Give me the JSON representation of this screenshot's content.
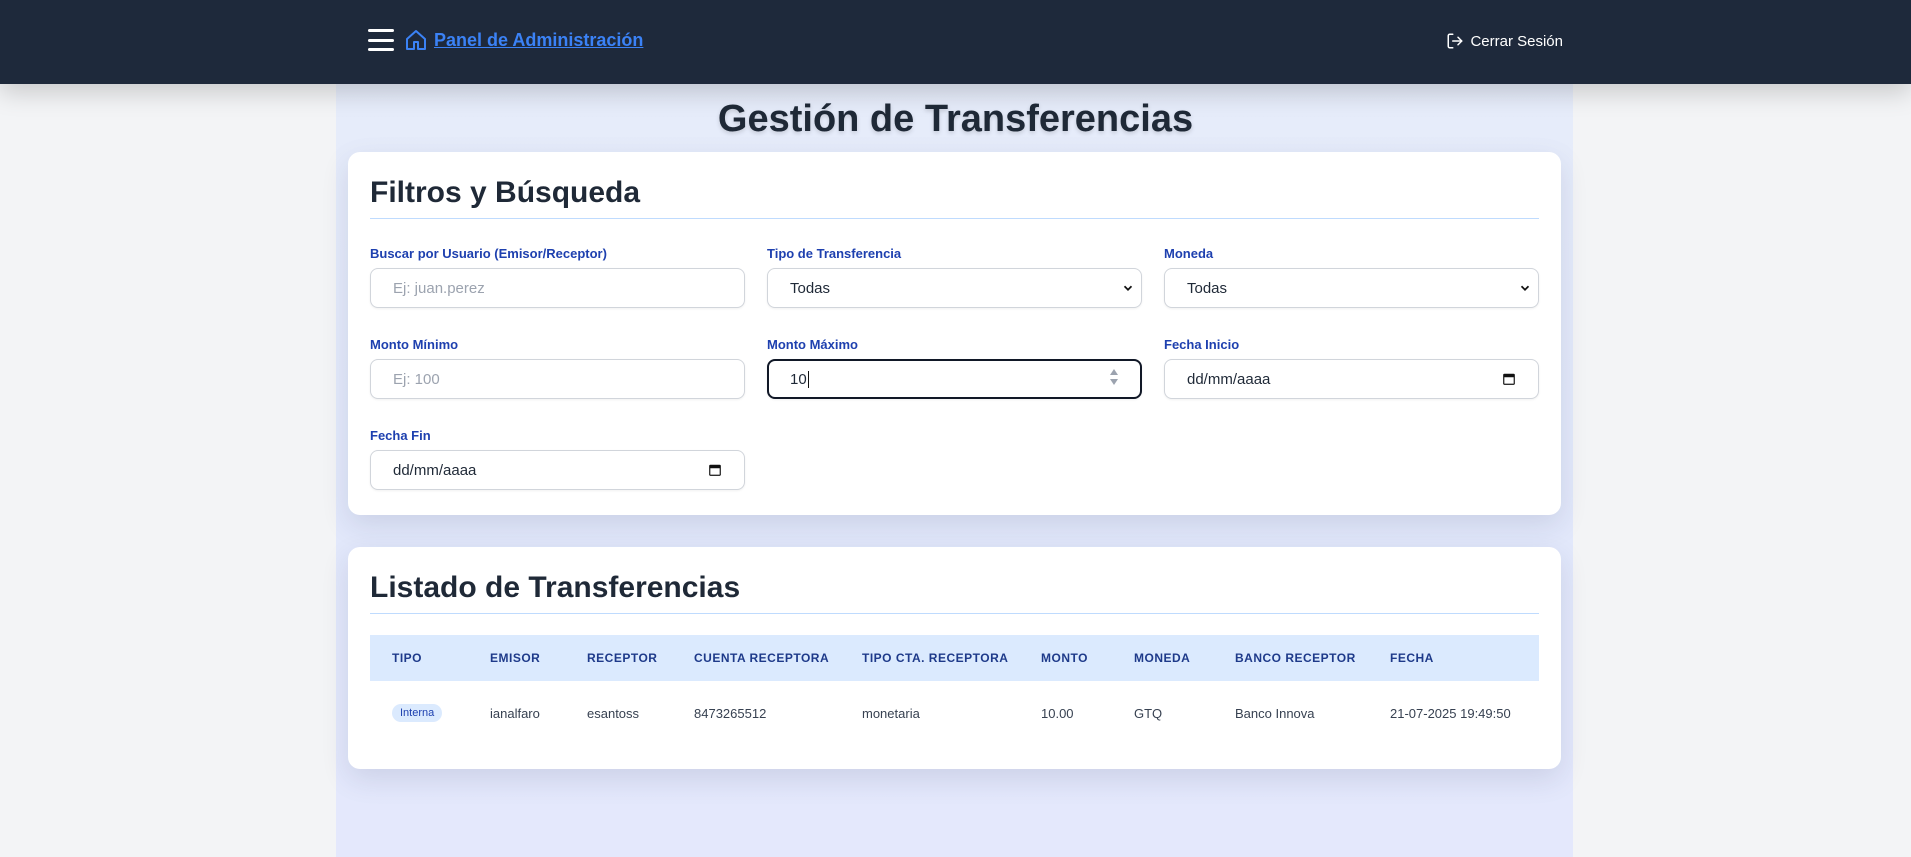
{
  "navbar": {
    "brand": "Panel de Administración",
    "logout_label": "Cerrar Sesión"
  },
  "page": {
    "title": "Gestión de Transferencias"
  },
  "filters": {
    "title": "Filtros y Búsqueda",
    "search_user": {
      "label": "Buscar por Usuario (Emisor/Receptor)",
      "placeholder": "Ej: juan.perez",
      "value": ""
    },
    "type": {
      "label": "Tipo de Transferencia",
      "value": "Todas"
    },
    "currency": {
      "label": "Moneda",
      "value": "Todas"
    },
    "min_amount": {
      "label": "Monto Mínimo",
      "placeholder": "Ej: 100",
      "value": ""
    },
    "max_amount": {
      "label": "Monto Máximo",
      "value": "10"
    },
    "start_date": {
      "label": "Fecha Inicio",
      "value": "dd/mm/aaaa"
    },
    "end_date": {
      "label": "Fecha Fin",
      "value": "dd/mm/aaaa"
    }
  },
  "listing": {
    "title": "Listado de Transferencias",
    "columns": [
      "TIPO",
      "EMISOR",
      "RECEPTOR",
      "CUENTA RECEPTORA",
      "TIPO CTA. RECEPTORA",
      "MONTO",
      "MONEDA",
      "BANCO RECEPTOR",
      "FECHA"
    ],
    "rows": [
      {
        "tipo": "Interna",
        "emisor": "ianalfaro",
        "receptor": "esantoss",
        "cuenta": "8473265512",
        "tipo_cta": "monetaria",
        "monto": "10.00",
        "moneda": "GTQ",
        "banco": "Banco Innova",
        "fecha": "21-07-2025 19:49:50"
      }
    ]
  },
  "colors": {
    "navbar_bg": "#1e293b",
    "brand": "#3b82f6",
    "label": "#1e40af",
    "table_head_bg": "#dbeafe"
  },
  "icons": {
    "menu": "hamburger-menu-icon",
    "home": "home-icon",
    "logout": "logout-icon",
    "calendar": "calendar-icon",
    "dropdown": "chevron-down-icon"
  }
}
